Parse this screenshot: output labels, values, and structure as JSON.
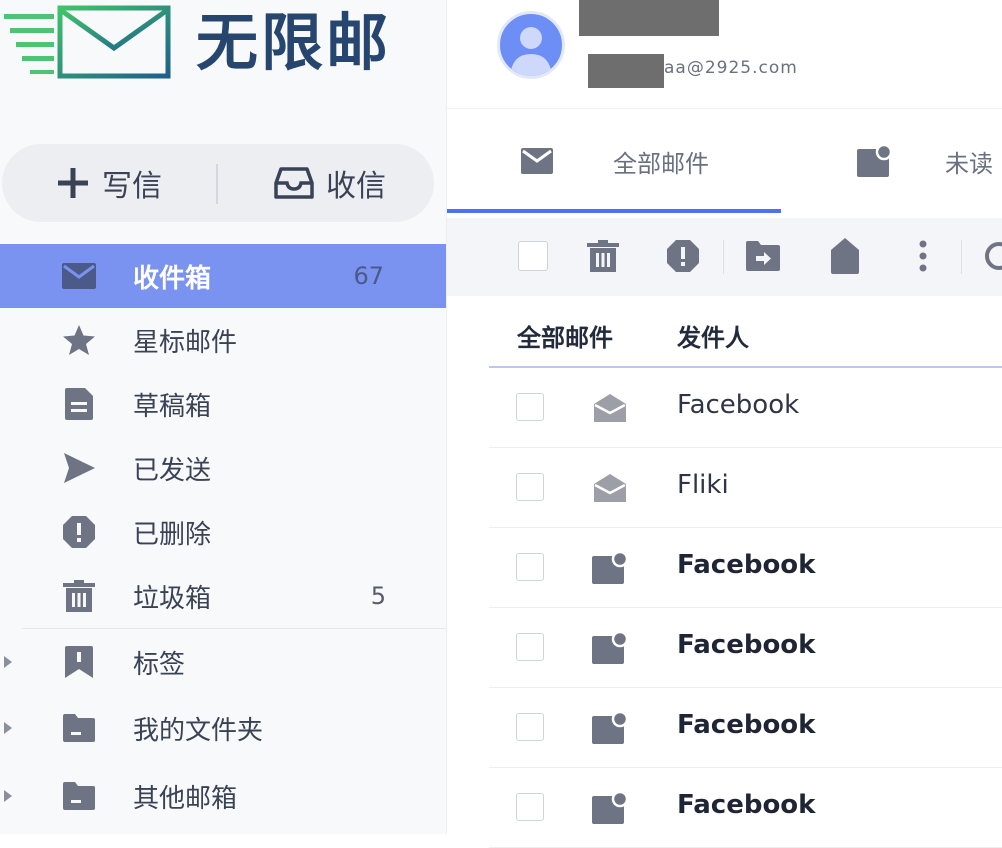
{
  "app": {
    "logo_text": "无限邮"
  },
  "compose": {
    "write_label": "写信",
    "receive_label": "收信"
  },
  "sidebar": {
    "items": [
      {
        "label": "收件箱",
        "count": "67",
        "icon": "inbox-mail-icon"
      },
      {
        "label": "星标邮件",
        "count": "",
        "icon": "star-icon"
      },
      {
        "label": "草稿箱",
        "count": "",
        "icon": "draft-icon"
      },
      {
        "label": "已发送",
        "count": "",
        "icon": "send-icon"
      },
      {
        "label": "已删除",
        "count": "",
        "icon": "deleted-icon"
      },
      {
        "label": "垃圾箱",
        "count": "5",
        "icon": "trash-icon"
      },
      {
        "label": "标签",
        "icon": "bookmark-icon"
      },
      {
        "label": "我的文件夹",
        "icon": "folder-icon"
      },
      {
        "label": "其他邮箱",
        "icon": "folder-icon"
      }
    ]
  },
  "user": {
    "email_fragment": "aa@2925.com"
  },
  "tabs": [
    {
      "label": "全部邮件",
      "icon": "mail-icon",
      "selected": true
    },
    {
      "label": "未读",
      "icon": "unread-mail-icon",
      "selected": false
    }
  ],
  "toolbar": {
    "icons": [
      "select-all-checkbox",
      "delete-icon",
      "spam-icon",
      "move-folder-icon",
      "tag-icon",
      "more-icon",
      "refresh-icon"
    ]
  },
  "list": {
    "header_all": "全部邮件",
    "header_sender": "发件人",
    "rows": [
      {
        "sender": "Facebook",
        "read": true
      },
      {
        "sender": "Fliki",
        "read": true
      },
      {
        "sender": "Facebook",
        "read": false
      },
      {
        "sender": "Facebook",
        "read": false
      },
      {
        "sender": "Facebook",
        "read": false
      },
      {
        "sender": "Facebook",
        "read": false
      }
    ]
  },
  "colors": {
    "accent": "#4a73f0",
    "active_nav": "#7b93f0",
    "icon_gray": "#6e7483",
    "logo_navy": "#27466f",
    "logo_green": "#3bbf6a"
  }
}
